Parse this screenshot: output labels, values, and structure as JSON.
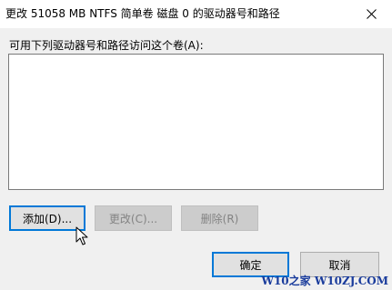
{
  "window": {
    "title": "更改 51058 MB NTFS 简单卷 磁盘 0 的驱动器号和路径",
    "close_icon": "close-icon"
  },
  "content": {
    "instruction": "可用下列驱动器号和路径访问这个卷(A):"
  },
  "buttons": {
    "add": "添加(D)...",
    "change": "更改(C)...",
    "remove": "删除(R)",
    "ok": "确定",
    "cancel": "取消"
  },
  "watermark": {
    "text": "W10之家 W10ZJ.COM"
  },
  "colors": {
    "accent": "#0078d7",
    "disabled_text": "#838383"
  }
}
